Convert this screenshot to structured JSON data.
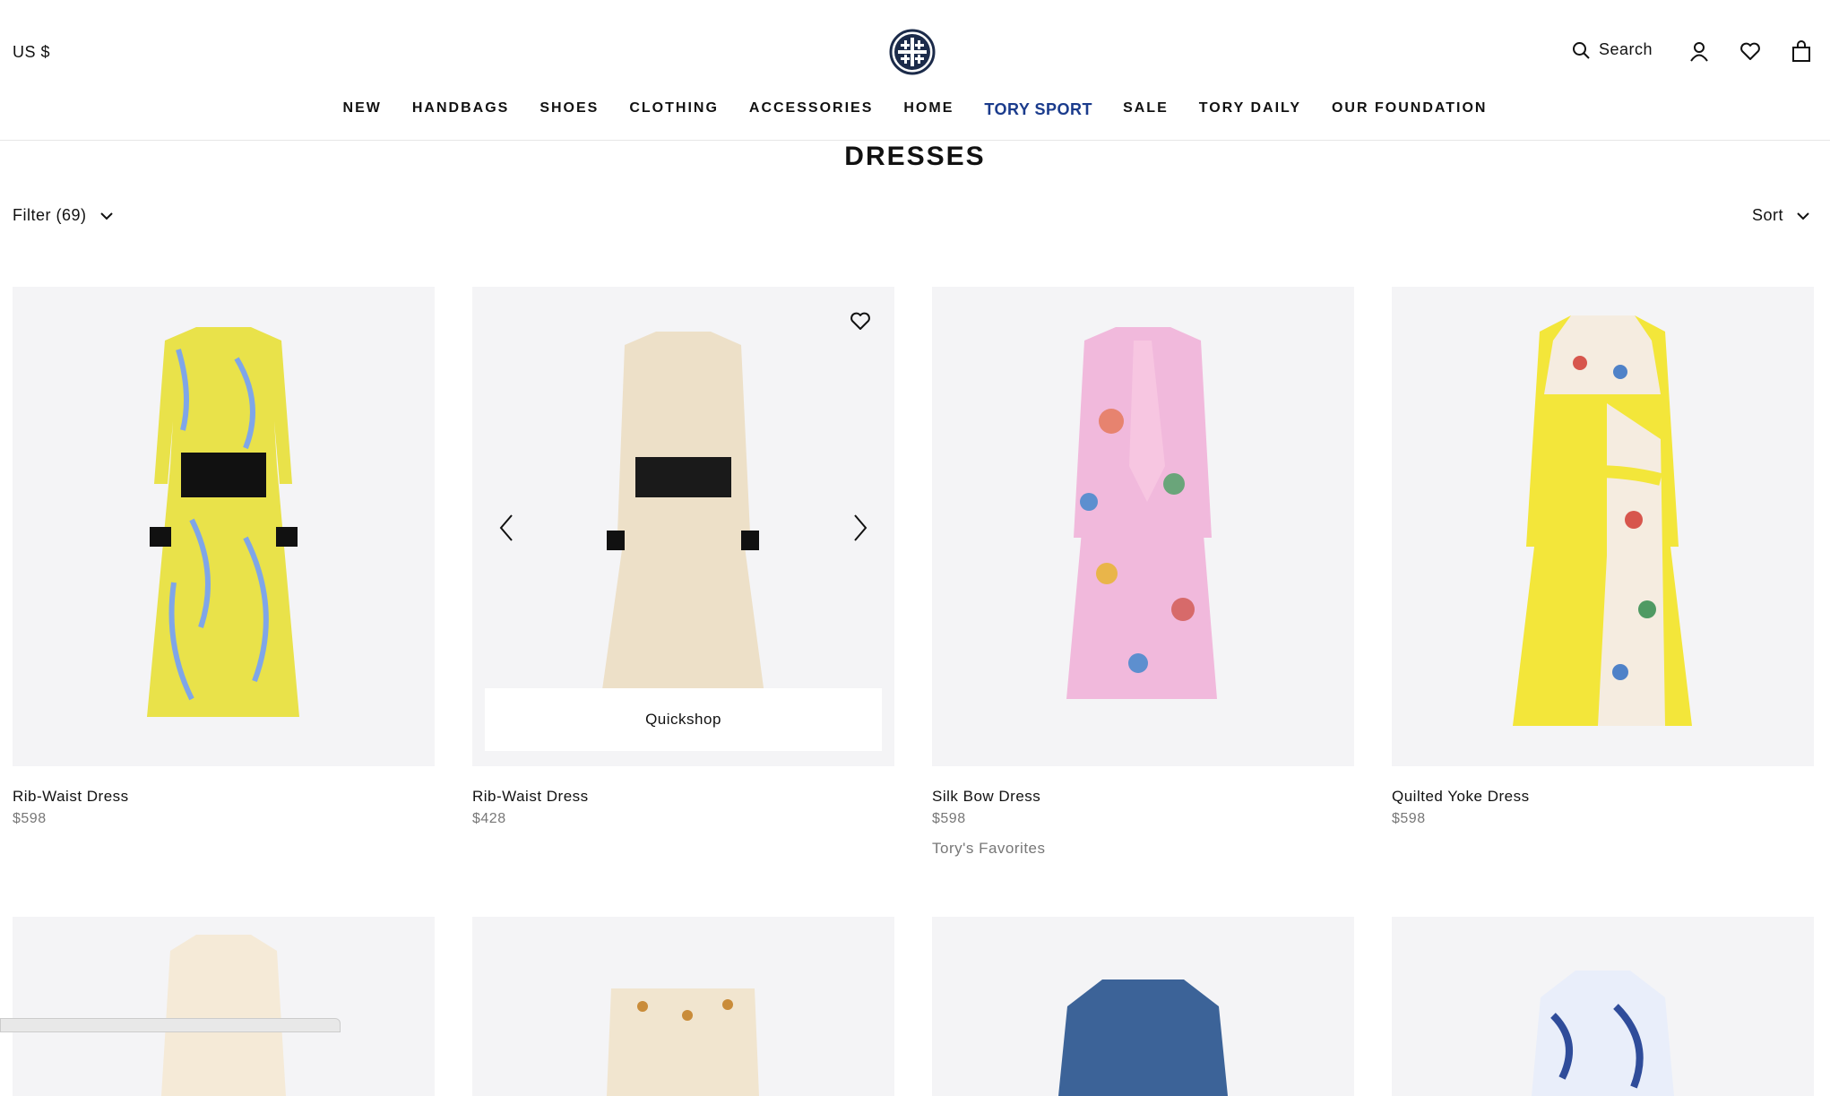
{
  "header": {
    "currency": "US $",
    "search_label": "Search"
  },
  "nav": [
    "NEW",
    "HANDBAGS",
    "SHOES",
    "CLOTHING",
    "ACCESSORIES",
    "HOME",
    "TORY SPORT",
    "SALE",
    "TORY DAILY",
    "OUR FOUNDATION"
  ],
  "page": {
    "title": "DRESSES",
    "filter_label": "Filter (69)",
    "sort_label": "Sort"
  },
  "products": [
    {
      "name": "Rib-Waist Dress",
      "price": "$598",
      "tag": ""
    },
    {
      "name": "Rib-Waist Dress",
      "price": "$428",
      "tag": "",
      "quickshop": "Quickshop"
    },
    {
      "name": "Silk Bow Dress",
      "price": "$598",
      "tag": "Tory's Favorites"
    },
    {
      "name": "Quilted Yoke Dress",
      "price": "$598",
      "tag": ""
    }
  ],
  "colors": {
    "brand_navy": "#1c2b4a",
    "sport_blue": "#1a3b8c",
    "tile_bg": "#f4f4f6"
  }
}
